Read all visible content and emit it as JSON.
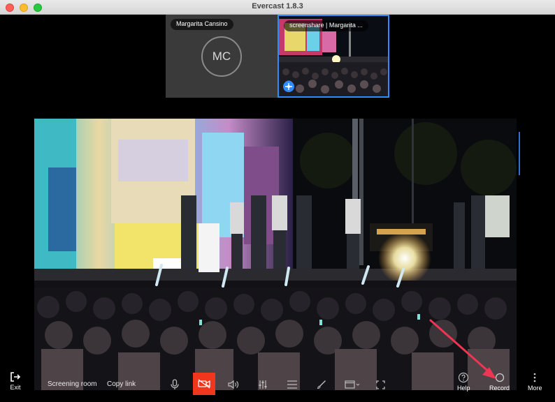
{
  "window": {
    "title": "Evercast 1.8.3"
  },
  "participants": [
    {
      "name": "Margarita Cansino",
      "initials": "MC"
    },
    {
      "name": "screenshare | Margarita ..."
    }
  ],
  "toolbar": {
    "exit_label": "Exit",
    "screening_room_label": "Screening room",
    "copy_link_label": "Copy link",
    "help_label": "Help",
    "record_label": "Record",
    "more_label": "More"
  },
  "icons": {
    "exit": "exit-icon",
    "mic": "microphone-icon",
    "camera_off": "camera-off-icon",
    "speaker": "speaker-icon",
    "mixer": "sliders-icon",
    "menu": "list-icon",
    "draw": "brush-icon",
    "layout": "layout-icon",
    "fullscreen": "fullscreen-icon",
    "help": "help-icon",
    "record": "record-icon",
    "more": "more-icon"
  },
  "colors": {
    "accent": "#2f8cff",
    "camera_off_bg": "#f1361d",
    "annotation_arrow": "#ee3553"
  }
}
